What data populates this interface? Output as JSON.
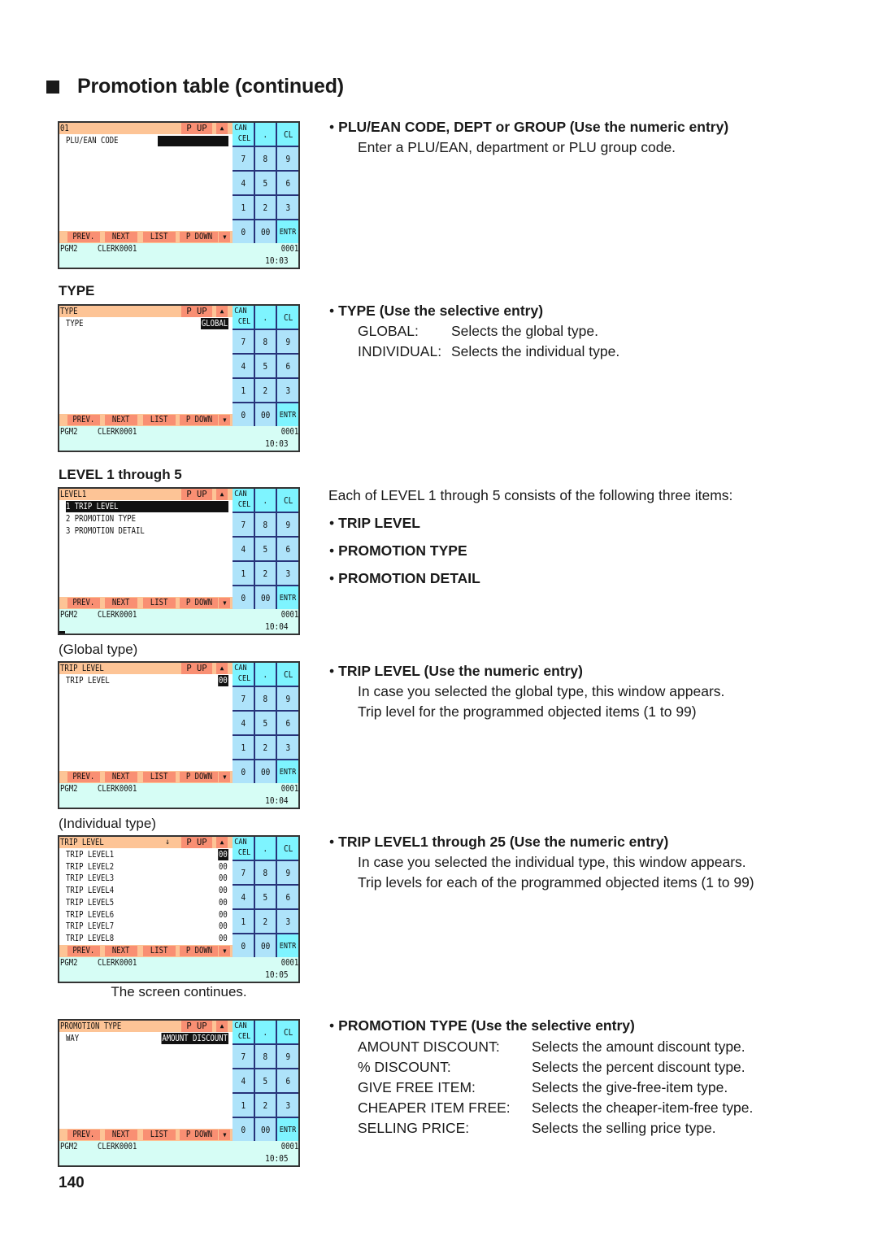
{
  "page": {
    "title": "Promotion table (continued)",
    "page_number": "140",
    "title_icon": "black-square-icon"
  },
  "captions": {
    "type": "TYPE",
    "level": "LEVEL 1 through 5",
    "global_type": "(Global type)",
    "individual_type": "(Individual type)",
    "screen_continues": "The screen continues."
  },
  "keypad": {
    "can1": "CAN",
    "can2": "CEL",
    "dot": ".",
    "cl": "CL",
    "k7": "7",
    "k8": "8",
    "k9": "9",
    "k4": "4",
    "k5": "5",
    "k6": "6",
    "k1": "1",
    "k2": "2",
    "k3": "3",
    "k0": "0",
    "k00": "00",
    "entr": "ENTR"
  },
  "common": {
    "p_up": "P UP",
    "up_arrow": "▲",
    "down_arrow": "▼",
    "prev": "PREV.",
    "next": "NEXT",
    "list": "LIST",
    "p_down": "P DOWN",
    "pgm": "PGM2",
    "clerk": "CLERK0001",
    "count": "0001"
  },
  "screens": {
    "plu": {
      "title": "01",
      "field": "PLU/EAN CODE",
      "value": "",
      "time": "10:03"
    },
    "type": {
      "title": "TYPE",
      "field": "TYPE",
      "value": "GLOBAL",
      "time": "10:03"
    },
    "level": {
      "title": "LEVEL1",
      "items": [
        "1 TRIP LEVEL",
        "2 PROMOTION TYPE",
        "3 PROMOTION DETAIL"
      ],
      "time": "10:04"
    },
    "trip_global": {
      "title": "TRIP LEVEL",
      "field": "TRIP LEVEL",
      "value": "00",
      "time": "10:04"
    },
    "trip_individual": {
      "title": "TRIP LEVEL",
      "scroll_indicator": "↓",
      "rows": [
        {
          "label": "TRIP LEVEL1",
          "value": "00"
        },
        {
          "label": "TRIP LEVEL2",
          "value": "00"
        },
        {
          "label": "TRIP LEVEL3",
          "value": "00"
        },
        {
          "label": "TRIP LEVEL4",
          "value": "00"
        },
        {
          "label": "TRIP LEVEL5",
          "value": "00"
        },
        {
          "label": "TRIP LEVEL6",
          "value": "00"
        },
        {
          "label": "TRIP LEVEL7",
          "value": "00"
        },
        {
          "label": "TRIP LEVEL8",
          "value": "00"
        }
      ],
      "time": "10:05"
    },
    "promo_type": {
      "title": "PROMOTION TYPE",
      "field": "WAY",
      "value": "AMOUNT DISCOUNT",
      "time": "10:05"
    }
  },
  "descriptions": {
    "plu": {
      "heading": "PLU/EAN CODE, DEPT or GROUP (Use the numeric entry)",
      "body": "Enter a PLU/EAN, department or PLU group code."
    },
    "type": {
      "heading": "TYPE (Use the selective entry)",
      "options": [
        {
          "key": "GLOBAL:",
          "desc": "Selects the global type."
        },
        {
          "key": "INDIVIDUAL:",
          "desc": "Selects the individual type."
        }
      ]
    },
    "level": {
      "intro": "Each of LEVEL 1 through 5 consists of the following three items:",
      "items": [
        "TRIP LEVEL",
        "PROMOTION TYPE",
        "PROMOTION DETAIL"
      ]
    },
    "trip_global": {
      "heading": "TRIP LEVEL (Use the numeric entry)",
      "lines": [
        "In case you selected the global type, this window appears.",
        "Trip level for the programmed objected items (1 to 99)"
      ]
    },
    "trip_individual": {
      "heading": "TRIP LEVEL1 through 25 (Use the numeric entry)",
      "lines": [
        "In case you selected the individual type, this window appears.",
        "Trip levels for each of the programmed objected items (1 to 99)"
      ]
    },
    "promo_type": {
      "heading": "PROMOTION TYPE (Use the selective entry)",
      "options": [
        {
          "key": "AMOUNT DISCOUNT:",
          "desc": "Selects the amount discount type."
        },
        {
          "key": "% DISCOUNT:",
          "desc": "Selects the percent discount type."
        },
        {
          "key": "GIVE FREE ITEM:",
          "desc": "Selects the give-free-item type."
        },
        {
          "key": "CHEAPER ITEM FREE:",
          "desc": "Selects the cheaper-item-free type."
        },
        {
          "key": "SELLING PRICE:",
          "desc": "Selects the selling price type."
        }
      ]
    }
  }
}
